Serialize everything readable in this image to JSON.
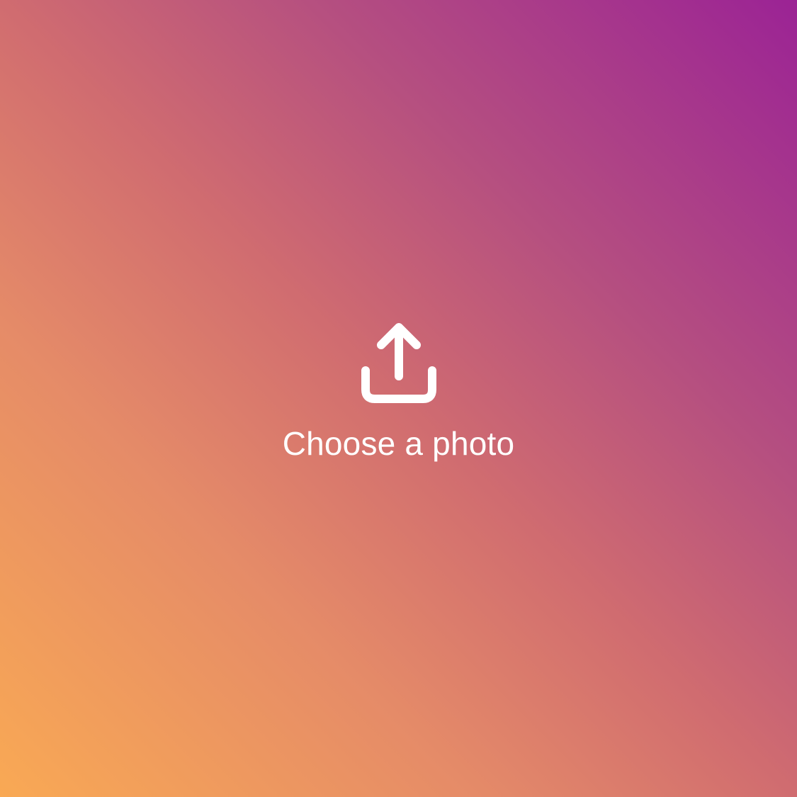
{
  "upload": {
    "label": "Choose a photo",
    "icon": "upload-icon"
  },
  "colors": {
    "gradient_start": "#f9a954",
    "gradient_mid": "#d06c70",
    "gradient_end": "#9b2395",
    "foreground": "#ffffff"
  }
}
